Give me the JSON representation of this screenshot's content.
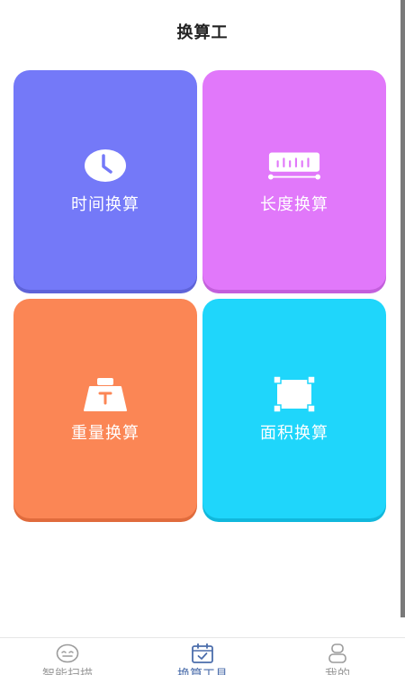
{
  "header": {
    "title": "换算工"
  },
  "cards": [
    {
      "label": "时间换算",
      "icon": "clock-icon",
      "color": "#7479f8"
    },
    {
      "label": "长度换算",
      "icon": "ruler-icon",
      "color": "#e178fa"
    },
    {
      "label": "重量换算",
      "icon": "weight-icon",
      "color": "#fb8655"
    },
    {
      "label": "面积换算",
      "icon": "area-icon",
      "color": "#1fd6fb"
    }
  ],
  "tabbar": {
    "items": [
      {
        "label": "智能扫描",
        "icon": "scan-face-icon",
        "active": false
      },
      {
        "label": "换算工具",
        "icon": "calendar-check-icon",
        "active": true
      },
      {
        "label": "我的",
        "icon": "user-icon",
        "active": false
      }
    ],
    "active_color": "#4b6dab",
    "inactive_color": "#9b9b9b"
  }
}
